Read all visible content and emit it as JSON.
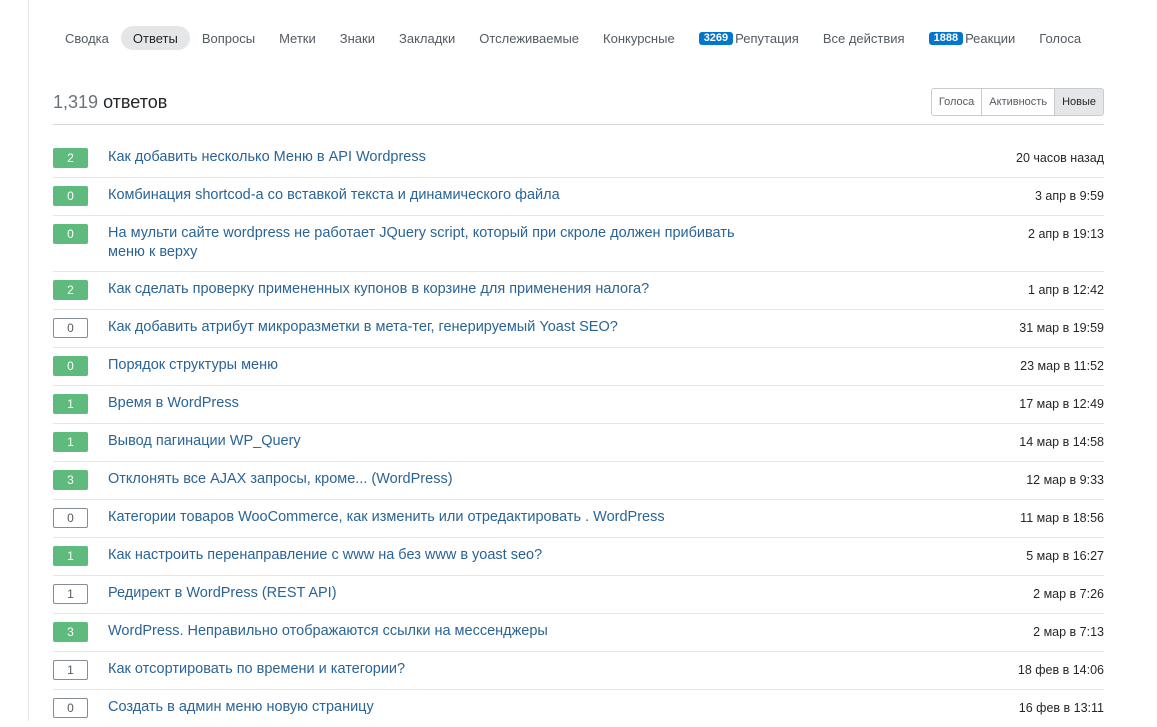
{
  "tabs": [
    {
      "label": "Сводка",
      "active": false,
      "badge": ""
    },
    {
      "label": "Ответы",
      "active": true,
      "badge": ""
    },
    {
      "label": "Вопросы",
      "active": false,
      "badge": ""
    },
    {
      "label": "Метки",
      "active": false,
      "badge": ""
    },
    {
      "label": "Знаки",
      "active": false,
      "badge": ""
    },
    {
      "label": "Закладки",
      "active": false,
      "badge": ""
    },
    {
      "label": "Отслеживаемые",
      "active": false,
      "badge": ""
    },
    {
      "label": "Конкурсные",
      "active": false,
      "badge": ""
    },
    {
      "label": "Репутация",
      "active": false,
      "badge": "3269"
    },
    {
      "label": "Все действия",
      "active": false,
      "badge": ""
    },
    {
      "label": "Реакции",
      "active": false,
      "badge": "1888"
    },
    {
      "label": "Голоса",
      "active": false,
      "badge": ""
    }
  ],
  "header": {
    "count": "1,319",
    "count_label": "ответов",
    "sort_options": [
      "Голоса",
      "Активность",
      "Новые"
    ],
    "sort_active": "Новые"
  },
  "colors": {
    "accepted": "#5eba7d",
    "link": "#2a6496",
    "badge": "#0077cc"
  },
  "answers": [
    {
      "score": "2",
      "accepted": true,
      "title": "Как добавить несколько Меню в API Wordpress",
      "date": "20 часов назад"
    },
    {
      "score": "0",
      "accepted": true,
      "title": "Комбинация shortcod-a со вставкой текста и динамического файла",
      "date": "3 апр в 9:59"
    },
    {
      "score": "0",
      "accepted": true,
      "title": "На мульти сайте wordpress не работает JQuery script, который при скроле должен прибивать меню к верху",
      "date": "2 апр в 19:13"
    },
    {
      "score": "2",
      "accepted": true,
      "title": "Как сделать проверку примененных купонов в корзине для применения налога?",
      "date": "1 апр в 12:42"
    },
    {
      "score": "0",
      "accepted": false,
      "title": "Как добавить атрибут микроразметки в мета-тег, генерируемый Yoast SEO?",
      "date": "31 мар в 19:59"
    },
    {
      "score": "0",
      "accepted": true,
      "title": "Порядок структуры меню",
      "date": "23 мар в 11:52"
    },
    {
      "score": "1",
      "accepted": true,
      "title": "Время в WordPress",
      "date": "17 мар в 12:49"
    },
    {
      "score": "1",
      "accepted": true,
      "title": "Вывод пагинации WP_Query",
      "date": "14 мар в 14:58"
    },
    {
      "score": "3",
      "accepted": true,
      "title": "Отклонять все AJAX запросы, кроме... (WordPress)",
      "date": "12 мар в 9:33"
    },
    {
      "score": "0",
      "accepted": false,
      "title": "Категории товаров WooCommerce, как изменить или отредактировать . WordPress",
      "date": "11 мар в 18:56"
    },
    {
      "score": "1",
      "accepted": true,
      "title": "Как настроить перенаправление с www на без www в yoast seo?",
      "date": "5 мар в 16:27"
    },
    {
      "score": "1",
      "accepted": false,
      "title": "Редирект в WordPress (REST API)",
      "date": "2 мар в 7:26"
    },
    {
      "score": "3",
      "accepted": true,
      "title": "WordPress. Неправильно отображаются ссылки на мессенджеры",
      "date": "2 мар в 7:13"
    },
    {
      "score": "1",
      "accepted": false,
      "title": "Как отсортировать по времени и категории?",
      "date": "18 фев в 14:06"
    },
    {
      "score": "0",
      "accepted": false,
      "title": "Создать в админ меню новую страницу",
      "date": "16 фев в 13:11"
    }
  ]
}
